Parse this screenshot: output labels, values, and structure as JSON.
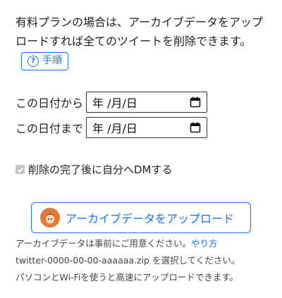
{
  "intro": {
    "text": "有料プランの場合は、アーカイブデータをアップロードすれば全てのツイートを削除できます。",
    "howto_label": "手順"
  },
  "date_from": {
    "label": "この日付から",
    "value": "年 /月/日"
  },
  "date_to": {
    "label": "この日付まで",
    "value": "年 /月/日"
  },
  "dm_option": {
    "label": "削除の完了後に自分へDMする",
    "checked": true,
    "disabled": true
  },
  "upload": {
    "label": "アーカイブデータをアップロード"
  },
  "notes": {
    "line1": "アーカイブデータは事前にご用意ください。",
    "line1_link": "やり方",
    "line2": "twitter-0000-00-00-aaaaaa.zip を選択してください。",
    "line3": "パソコンとWi-Fiを使うと高速にアップロードできます。"
  },
  "colors": {
    "accent": "#1a73e8",
    "text": "#222222",
    "muted": "#444444"
  }
}
